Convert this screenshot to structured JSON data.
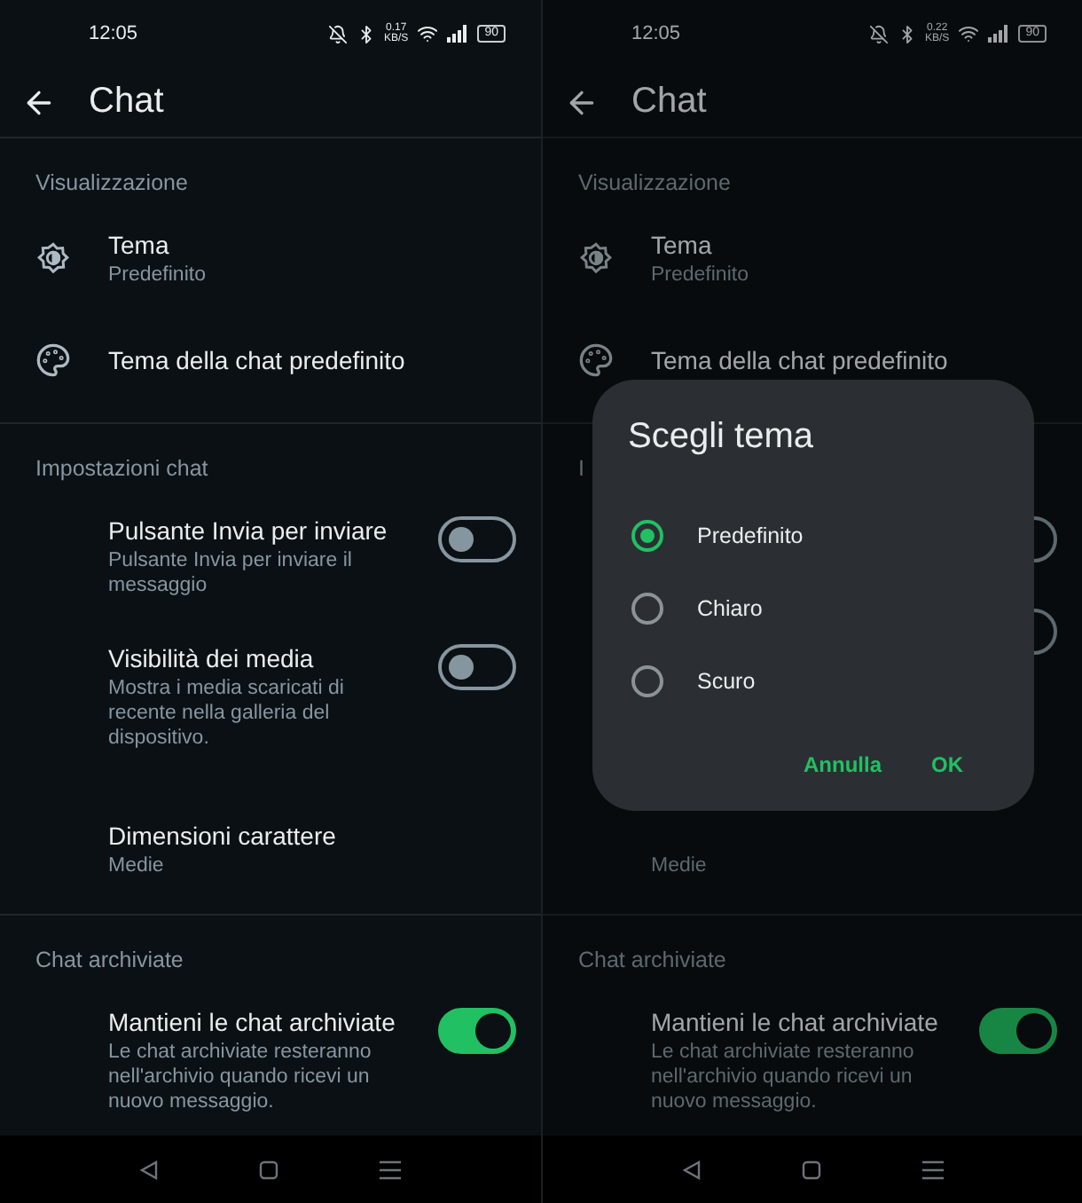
{
  "screens": [
    {
      "status_bar": {
        "time": "12:05",
        "net_speed": "0.17",
        "net_unit": "KB/S",
        "battery": "90"
      },
      "title": "Chat",
      "sections": [
        {
          "heading": "Visualizzazione",
          "items": [
            {
              "kind": "brightness",
              "title": "Tema",
              "subtitle": "Predefinito"
            },
            {
              "kind": "palette",
              "title": "Tema della chat predefinito"
            }
          ]
        },
        {
          "heading": "Impostazioni chat",
          "items": [
            {
              "kind": "toggle",
              "title": "Pulsante Invia per inviare",
              "subtitle": "Pulsante Invia per inviare il messaggio",
              "on": false
            },
            {
              "kind": "toggle",
              "title": "Visibilità dei media",
              "subtitle": "Mostra i media scaricati di recente nella galleria del dispositivo.",
              "on": false
            },
            {
              "kind": "value",
              "title": "Dimensioni carattere",
              "subtitle": "Medie"
            }
          ]
        },
        {
          "heading": "Chat archiviate",
          "items": [
            {
              "kind": "toggle",
              "title": "Mantieni le chat archiviate",
              "subtitle": "Le chat archiviate resteranno nell'archivio quando ricevi un nuovo messaggio.",
              "on": true
            }
          ]
        }
      ]
    },
    {
      "status_bar": {
        "time": "12:05",
        "net_speed": "0.22",
        "net_unit": "KB/S",
        "battery": "90"
      },
      "title": "Chat",
      "sections": [
        {
          "heading": "Visualizzazione",
          "items": [
            {
              "kind": "brightness",
              "title": "Tema",
              "subtitle": "Predefinito"
            },
            {
              "kind": "palette",
              "title": "Tema della chat predefinito"
            }
          ]
        },
        {
          "heading": "I",
          "items": [
            {
              "kind": "toggle",
              "on": false
            },
            {
              "kind": "toggle",
              "on": false
            },
            {
              "kind": "value",
              "subtitle": "Medie"
            }
          ]
        },
        {
          "heading": "Chat archiviate",
          "items": [
            {
              "kind": "toggle",
              "title": "Mantieni le chat archiviate",
              "subtitle": "Le chat archiviate resteranno nell'archivio quando ricevi un nuovo messaggio.",
              "on": true
            }
          ]
        }
      ],
      "dialog": {
        "title": "Scegli tema",
        "options": [
          {
            "label": "Predefinito",
            "selected": true
          },
          {
            "label": "Chiaro",
            "selected": false
          },
          {
            "label": "Scuro",
            "selected": false
          }
        ],
        "buttons": [
          "Annulla",
          "OK"
        ]
      }
    }
  ]
}
